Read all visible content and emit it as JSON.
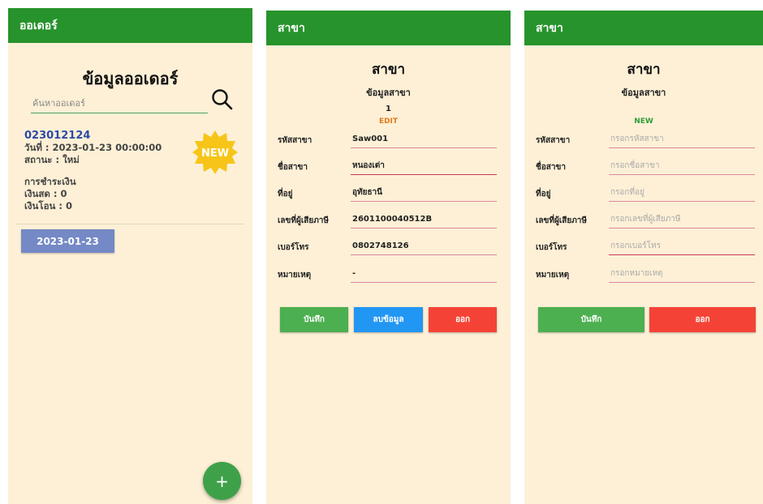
{
  "screen1": {
    "appbar_title": "ออเดอร์",
    "title": "ข้อมูลออเดอร์",
    "search_placeholder": "ค้นหาออเดอร์",
    "order": {
      "id": "023012124",
      "date_line": "วันที่ : 2023-01-23 00:00:00",
      "status_line": "สถานะ : ใหม่",
      "payment_title": "การชำระเงิน",
      "cash_line": "เงินสด : 0",
      "transfer_line": "เงินโอน : 0",
      "badge": "NEW"
    },
    "date_button": "2023-01-23",
    "fab_label": "+"
  },
  "screen2": {
    "appbar_title": "สาขา",
    "title": "สาขา",
    "subtitle": "ข้อมูลสาขา",
    "record_id": "1",
    "mode": "EDIT",
    "fields": [
      {
        "label": "รหัสสาขา",
        "value": "Saw001"
      },
      {
        "label": "ชื่อสาขา",
        "value": "หนองเต่า"
      },
      {
        "label": "ที่อยู่",
        "value": "อุทัยธานี"
      },
      {
        "label": "เลขที่ผู้เสียภาษี",
        "value": "2601100040512B"
      },
      {
        "label": "เบอร์โทร",
        "value": "0802748126"
      },
      {
        "label": "หมายเหตุ",
        "value": "-"
      }
    ],
    "buttons": {
      "save": "บันทึก",
      "delete": "ลบข้อมูล",
      "exit": "ออก"
    }
  },
  "screen3": {
    "appbar_title": "สาขา",
    "title": "สาขา",
    "subtitle": "ข้อมูลสาขา",
    "mode": "NEW",
    "fields": [
      {
        "label": "รหัสสาขา",
        "placeholder": "กรอกรหัสสาขา"
      },
      {
        "label": "ชื่อสาขา",
        "placeholder": "กรอกชื่อสาขา"
      },
      {
        "label": "ที่อยู่",
        "placeholder": "กรอกที่อยู่"
      },
      {
        "label": "เลขที่ผู้เสียภาษี",
        "placeholder": "กรอกเลขที่ผู้เสียภาษี"
      },
      {
        "label": "เบอร์โทร",
        "placeholder": "กรอกเบอร์โทร"
      },
      {
        "label": "หมายเหตุ",
        "placeholder": "กรอกหมายเหตุ"
      }
    ],
    "buttons": {
      "save": "บันทึก",
      "exit": "ออก"
    }
  },
  "colors": {
    "appbar": "#27932c",
    "background": "#fdf0d6",
    "order_id": "#2c4aa8",
    "date_button": "#7489c6",
    "edit_label": "#e07a17",
    "new_label": "#2f9d3a",
    "save_button": "#4caf50",
    "delete_button": "#2196f3",
    "exit_button": "#f44336"
  },
  "icons": {
    "search": "search-icon",
    "new_badge": "new-badge-starburst",
    "fab": "plus-icon"
  }
}
